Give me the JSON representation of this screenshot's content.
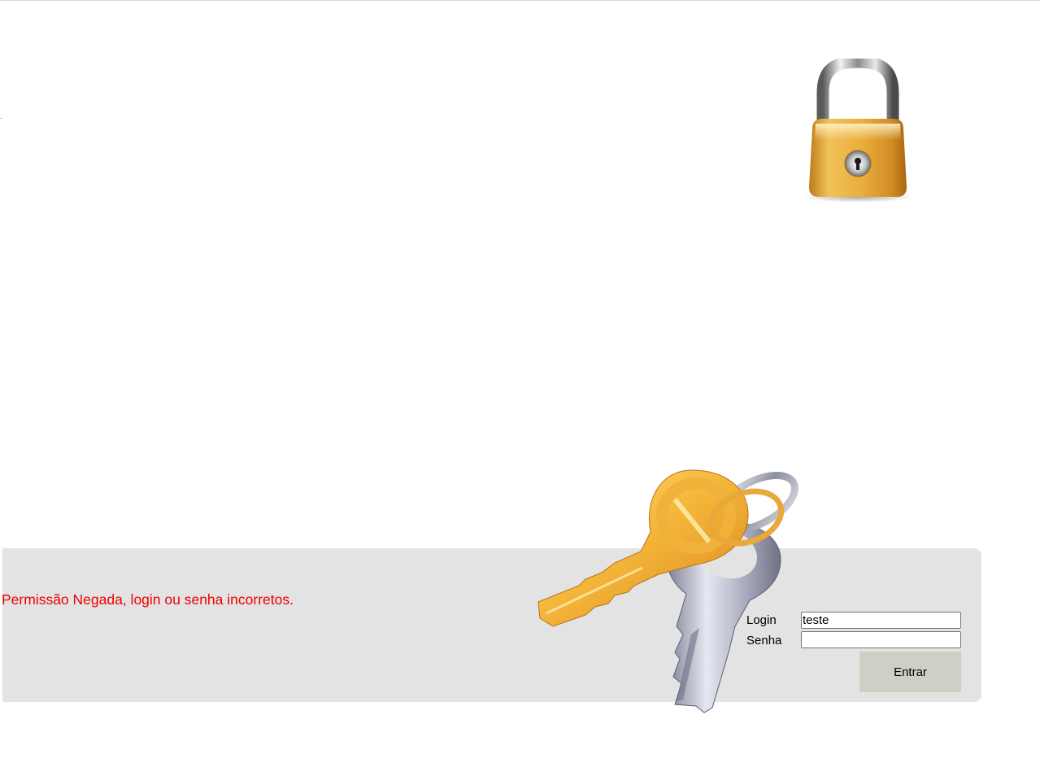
{
  "message": {
    "error_text": "Permissão Negada, login ou senha incorretos.",
    "error_color": "#f00000"
  },
  "form": {
    "login_label": "Login",
    "login_value": "teste",
    "password_label": "Senha",
    "password_value": "",
    "submit_label": "Entrar"
  },
  "images": {
    "top_icon": "padlock-icon",
    "bottom_icon": "keys-icon"
  },
  "colors": {
    "panel_background": "#e3e3e3",
    "button_background": "#cfcfc5",
    "padlock_gold": "#e0a532",
    "key_gold": "#f0b23a",
    "key_silver": "#b9bccb"
  }
}
